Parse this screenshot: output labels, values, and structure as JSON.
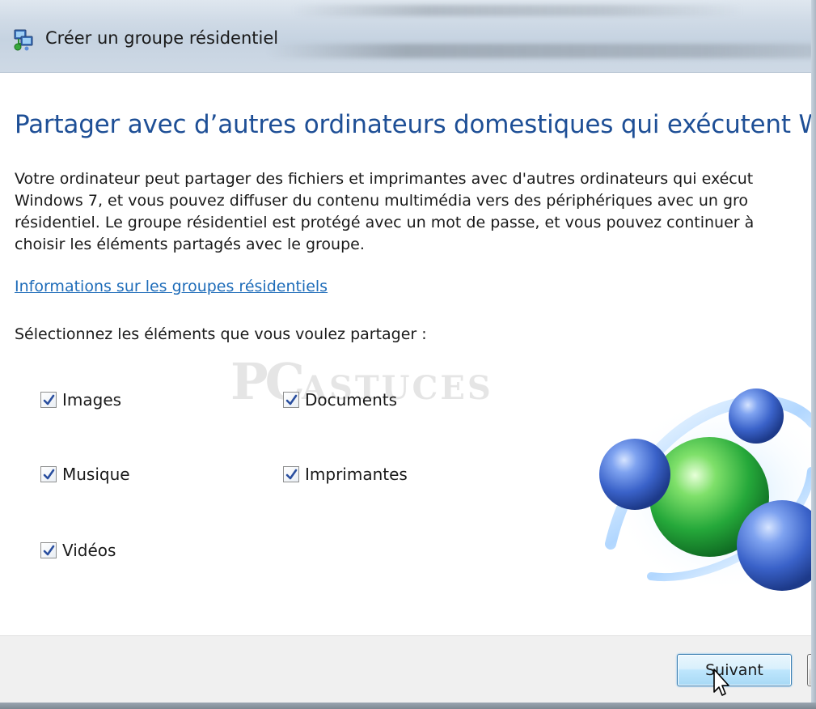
{
  "window": {
    "title": "Créer un groupe résidentiel",
    "icon": "homegroup-network-icon"
  },
  "content": {
    "heading": "Partager avec d’autres ordinateurs domestiques qui exécutent Windows",
    "description_lines": [
      "Votre ordinateur peut partager des fichiers et imprimantes avec d'autres ordinateurs qui exécut",
      "Windows 7, et vous pouvez diffuser du contenu multimédia vers des périphériques avec un gro",
      "résidentiel. Le groupe résidentiel est protégé avec un mot de passe, et vous pouvez continuer à",
      "choisir les éléments partagés avec le groupe."
    ],
    "info_link": "Informations sur les groupes résidentiels",
    "select_label": "Sélectionnez les éléments que vous voulez partager :",
    "watermark": {
      "big": "PC",
      "small": "ASTUCES"
    },
    "items": [
      {
        "label": "Images",
        "checked": true
      },
      {
        "label": "Documents",
        "checked": true
      },
      {
        "label": "Musique",
        "checked": true
      },
      {
        "label": "Imprimantes",
        "checked": true
      },
      {
        "label": "Vidéos",
        "checked": true
      }
    ]
  },
  "footer": {
    "next_label": "Suivant",
    "cancel_label": ""
  },
  "colors": {
    "heading": "#1e4f96",
    "link": "#1e6cb9",
    "sphere_blue": "#3f6fd6",
    "sphere_green": "#2fb83c",
    "checkmark": "#2a4f9f"
  }
}
